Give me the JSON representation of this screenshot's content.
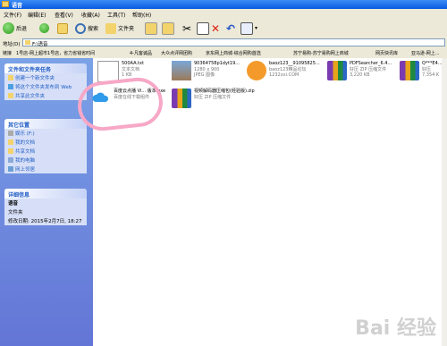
{
  "window": {
    "title": "语音"
  },
  "menu": [
    "文件(F)",
    "编辑(E)",
    "查看(V)",
    "收藏(A)",
    "工具(T)",
    "帮助(H)"
  ],
  "toolbar": {
    "back": "后退",
    "search": "搜索",
    "folders": "文件夹"
  },
  "address": {
    "label": "地址(D)",
    "path": "F:\\语音"
  },
  "links": {
    "label": "链接",
    "items": [
      "1号店-网上超市1号店，省力省钱省时间",
      "4-凡客诚品",
      "大众点评网团购",
      "京东网上商城-综合网购首选",
      "苏宁易购-苏宁易购网上商城",
      "网页快讯库",
      "亚马逊-网上..."
    ]
  },
  "tasks": {
    "title": "文件和文件夹任务",
    "items": [
      "创建一个新文件夹",
      "将这个文件夹发布到 Web",
      "共享此文件夹"
    ]
  },
  "places": {
    "title": "其它位置",
    "items": [
      "娱乐 (F:)",
      "我的文档",
      "共享文档",
      "我的电脑",
      "网上邻居"
    ]
  },
  "details": {
    "title": "详细信息",
    "name": "语音",
    "type": "文件夹",
    "modified": "修改日期: 2015年2月7日, 18:27"
  },
  "files": [
    {
      "name": "500AA.txt",
      "line2": "文本文档",
      "line3": "1 KB"
    },
    {
      "name": "90364758p1dyt19...",
      "line2": "1280 x 900",
      "line3": "JPEG 图像"
    },
    {
      "name": "baoz123__91095825...",
      "line2": "baoz123精品论坛",
      "line3": "1232xxi.COM"
    },
    {
      "name": "PDFSearcher_6.4...",
      "line2": "好压 ZIP 压缩文件",
      "line3": "3,220 KB"
    },
    {
      "name": "Q***E4...",
      "line2": "好压",
      "line3": "7,354 K"
    },
    {
      "name": "百度云点播 Vi... 版本.exe",
      "line2": "百度在线下载组件",
      "line3": ""
    },
    {
      "name": "视频解码器压缩包(经验版).zip",
      "line2": "好压 ZIP 压缩文件",
      "line3": ""
    }
  ],
  "watermark": "Bai 经验"
}
